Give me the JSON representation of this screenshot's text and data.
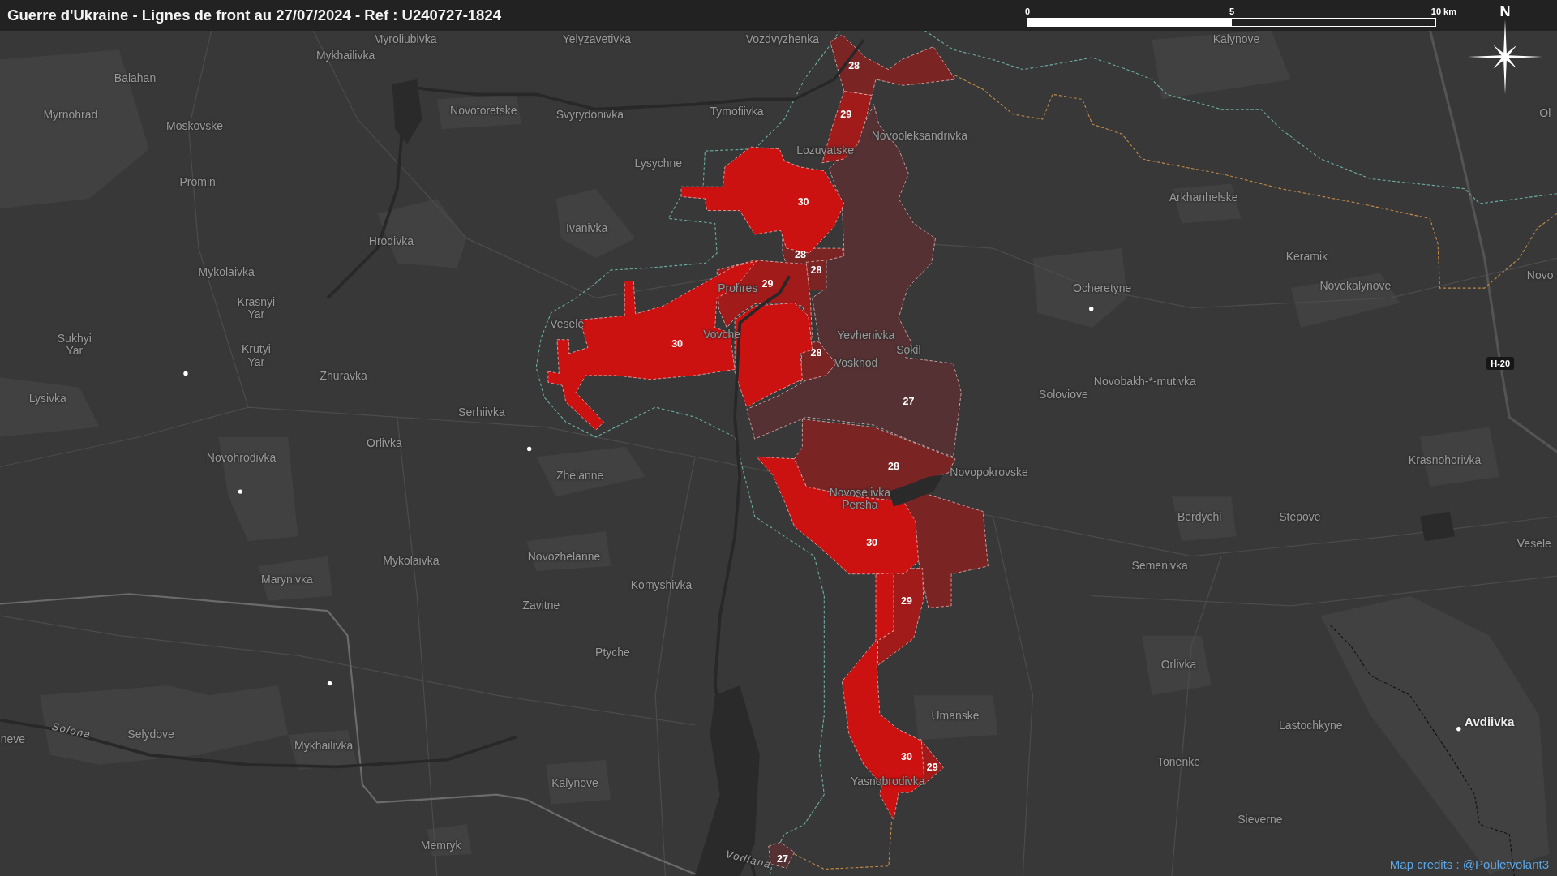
{
  "title_bar": {
    "title": "Guerre d'Ukraine - Lignes de front au 27/07/2024 - Ref : U240727-1824"
  },
  "scale_bar": {
    "labels": [
      "0",
      "5",
      "10 km"
    ]
  },
  "north_arrow": {
    "label": "N"
  },
  "map": {
    "places": [
      {
        "name": "Myroliubivka",
        "kind": "village"
      },
      {
        "name": "Yelyzavetivka",
        "kind": "village"
      },
      {
        "name": "Vozdvyzhenka",
        "kind": "village"
      },
      {
        "name": "Kalynove",
        "kind": "village"
      },
      {
        "name": "Mykhailivka",
        "kind": "village"
      },
      {
        "name": "Balahan",
        "kind": "village"
      },
      {
        "name": "Myrnohrad",
        "kind": "village"
      },
      {
        "name": "Novotoretske",
        "kind": "village"
      },
      {
        "name": "Svyrydonivka",
        "kind": "village"
      },
      {
        "name": "Tymofiivka",
        "kind": "village"
      },
      {
        "name": "Ol",
        "kind": "village"
      },
      {
        "name": "Moskovske",
        "kind": "village"
      },
      {
        "name": "Novooleksandrivka",
        "kind": "village"
      },
      {
        "name": "Lozuvatske",
        "kind": "village"
      },
      {
        "name": "Lysychne",
        "kind": "village"
      },
      {
        "name": "Promin",
        "kind": "village"
      },
      {
        "name": "Arkhanhelske",
        "kind": "village"
      },
      {
        "name": "Ivanivka",
        "kind": "village"
      },
      {
        "name": "Hrodivka",
        "kind": "village"
      },
      {
        "name": "Keramik",
        "kind": "village"
      },
      {
        "name": "Mykolaivka",
        "kind": "village"
      },
      {
        "name": "Novo",
        "kind": "village"
      },
      {
        "name": "Prohres",
        "kind": "village"
      },
      {
        "name": "Ocheretyne",
        "kind": "village"
      },
      {
        "name": "Novokalynove",
        "kind": "village"
      },
      {
        "name": "Krasnyi Yar",
        "kind": "village"
      },
      {
        "name": "Vesele",
        "kind": "village"
      },
      {
        "name": "Sukhyi Yar",
        "kind": "village"
      },
      {
        "name": "Vovche",
        "kind": "village"
      },
      {
        "name": "Yevhenivka",
        "kind": "village"
      },
      {
        "name": "Krutyi Yar",
        "kind": "village"
      },
      {
        "name": "Sokil",
        "kind": "village"
      },
      {
        "name": "Voskhod",
        "kind": "village"
      },
      {
        "name": "Zhuravka",
        "kind": "village"
      },
      {
        "name": "Novobakh-*-mutivka",
        "kind": "village"
      },
      {
        "name": "Lysivka",
        "kind": "village"
      },
      {
        "name": "Soloviove",
        "kind": "village"
      },
      {
        "name": "Serhiivka",
        "kind": "village"
      },
      {
        "name": "Orlivka",
        "kind": "village"
      },
      {
        "name": "Novohrodivka",
        "kind": "village"
      },
      {
        "name": "Krasnohorivka",
        "kind": "village"
      },
      {
        "name": "Zhelanne",
        "kind": "village"
      },
      {
        "name": "Novopokrovske",
        "kind": "village"
      },
      {
        "name": "Novoselivka Persha",
        "kind": "village"
      },
      {
        "name": "Berdychi",
        "kind": "village"
      },
      {
        "name": "Stepove",
        "kind": "village"
      },
      {
        "name": "Vesele",
        "kind": "village"
      },
      {
        "name": "Mykolaivka",
        "kind": "village"
      },
      {
        "name": "Novozhelanne",
        "kind": "village"
      },
      {
        "name": "Semenivka",
        "kind": "village"
      },
      {
        "name": "Marynivka",
        "kind": "village"
      },
      {
        "name": "Komyshivka",
        "kind": "village"
      },
      {
        "name": "Zavitne",
        "kind": "village"
      },
      {
        "name": "Ptyche",
        "kind": "village"
      },
      {
        "name": "Orlivka",
        "kind": "village"
      },
      {
        "name": "Umanske",
        "kind": "village"
      },
      {
        "name": "Lastochkyne",
        "kind": "village"
      },
      {
        "name": "Avdiivka",
        "kind": "city"
      },
      {
        "name": "neve",
        "kind": "village"
      },
      {
        "name": "Solona",
        "kind": "river"
      },
      {
        "name": "Selydove",
        "kind": "village"
      },
      {
        "name": "Mykhailivka",
        "kind": "village"
      },
      {
        "name": "Tonenke",
        "kind": "village"
      },
      {
        "name": "Kalynove",
        "kind": "village"
      },
      {
        "name": "Yasnobrodivka",
        "kind": "village"
      },
      {
        "name": "Sieverne",
        "kind": "village"
      },
      {
        "name": "Memryk",
        "kind": "village"
      },
      {
        "name": "Vodiana",
        "kind": "river"
      }
    ],
    "zones": [
      {
        "label": "28",
        "color": "#7b2424"
      },
      {
        "label": "29",
        "color": "#a11b1b"
      },
      {
        "label": "30",
        "color": "#cc1111"
      },
      {
        "label": "28",
        "color": "#7b2424"
      },
      {
        "label": "28",
        "color": "#7b2424"
      },
      {
        "label": "29",
        "color": "#a11b1b"
      },
      {
        "label": "30",
        "color": "#cc1111"
      },
      {
        "label": "28",
        "color": "#7b2424"
      },
      {
        "label": "27",
        "color": "#553133"
      },
      {
        "label": "28",
        "color": "#7b2424"
      },
      {
        "label": "30",
        "color": "#cc1111"
      },
      {
        "label": "29",
        "color": "#a11b1b"
      },
      {
        "label": "30",
        "color": "#cc1111"
      },
      {
        "label": "29",
        "color": "#a11b1b"
      },
      {
        "label": "27",
        "color": "#553133"
      }
    ],
    "road_sign": "H-20"
  },
  "credits": "Map credits : @Pouletvolant3"
}
